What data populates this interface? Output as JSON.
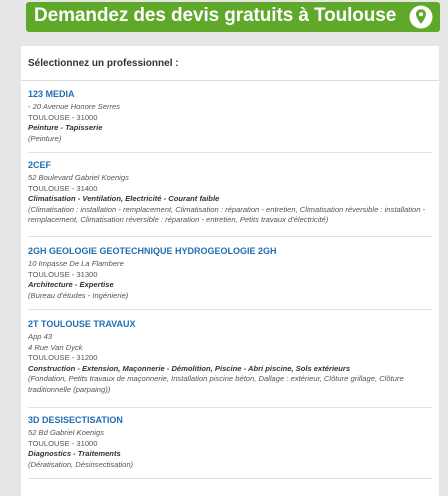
{
  "header": {
    "title": "Demandez des devis gratuits à Toulouse",
    "bg_color": "#5fa82a",
    "icon": "map-pin-icon"
  },
  "panel": {
    "heading": "Sélectionnez un professionnel :"
  },
  "professionals": [
    {
      "name": "123 MEDIA",
      "address": [
        "- 20 Avenue Honore Serres"
      ],
      "city": "TOULOUSE - 31000",
      "trades": "Peinture - Tapisserie",
      "details": "(Peinture)"
    },
    {
      "name": "2CEF",
      "address": [
        "52 Boulevard Gabriel Koenigs"
      ],
      "city": "TOULOUSE - 31400",
      "trades": "Climatisation - Ventilation, Electricité - Courant faible",
      "details": "(Climatisation : installation - remplacement, Climatisation : réparation - entretien, Climatisation réversible : installation - remplacement, Climatisation réversible : réparation - entretien, Petits travaux d'électricité)"
    },
    {
      "name": "2GH GEOLOGIE GEOTECHNIQUE HYDROGEOLOGIE 2GH",
      "address": [
        "10 Impasse De La Flambere"
      ],
      "city": "TOULOUSE - 31300",
      "trades": "Architecture - Expertise",
      "details": "(Bureau d'études - Ingénierie)"
    },
    {
      "name": "2T TOULOUSE TRAVAUX",
      "address": [
        "App 43",
        "4 Rue Van Dyck"
      ],
      "city": "TOULOUSE - 31200",
      "trades": "Construction - Extension, Maçonnerie - Démolition, Piscine - Abri piscine, Sols extérieurs",
      "details": "(Fondation, Petits travaux de maçonnerie, Installation piscine béton, Dallage : extérieur, Clôture grillage, Clôture traditionnelle (parpaing))"
    },
    {
      "name": "3D DESISECTISATION",
      "address": [
        "52 Bd Gabriel Koenigs"
      ],
      "city": "TOULOUSE - 31000",
      "trades": "Diagnostics - Traitements",
      "details": "(Dératisation, Désinsectisation)"
    }
  ]
}
